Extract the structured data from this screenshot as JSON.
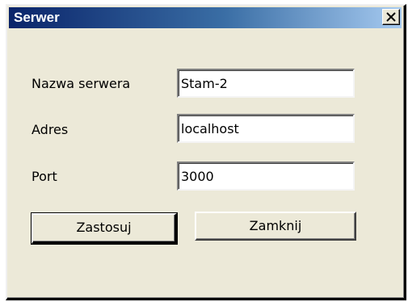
{
  "window": {
    "title": "Serwer",
    "close_icon": "close-x-icon"
  },
  "form": {
    "server_name_label": "Nazwa serwera",
    "server_name_value": "Stam-2",
    "address_label": "Adres",
    "address_value": "localhost",
    "port_label": "Port",
    "port_value": "3000"
  },
  "buttons": {
    "apply_label": "Zastosuj",
    "close_label": "Zamknij"
  },
  "colors": {
    "titlebar_start": "#0a246a",
    "titlebar_end": "#a6caf0",
    "dialog_bg": "#ece9d8"
  }
}
